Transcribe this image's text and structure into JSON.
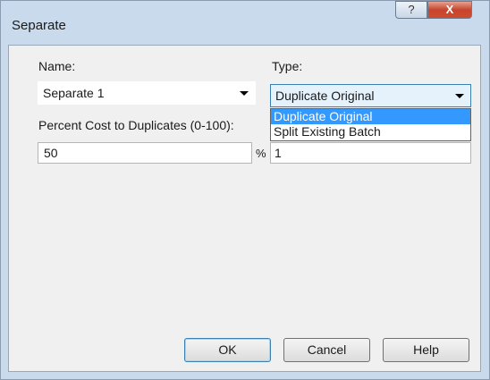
{
  "window": {
    "title": "Separate"
  },
  "titlebar": {
    "help_glyph": "?",
    "close_glyph": "X"
  },
  "form": {
    "name_label": "Name:",
    "name_value": "Separate 1",
    "type_label": "Type:",
    "type_value": "Duplicate Original",
    "type_options": [
      "Duplicate Original",
      "Split Existing Batch"
    ],
    "percent_label": "Percent Cost to Duplicates (0-100):",
    "percent_value": "50",
    "percent_unit": "%",
    "second_value": "1"
  },
  "buttons": {
    "ok": "OK",
    "cancel": "Cancel",
    "help": "Help"
  },
  "colors": {
    "selection": "#3399ff",
    "close_button": "#c5452c",
    "frame": "#c9daed"
  }
}
